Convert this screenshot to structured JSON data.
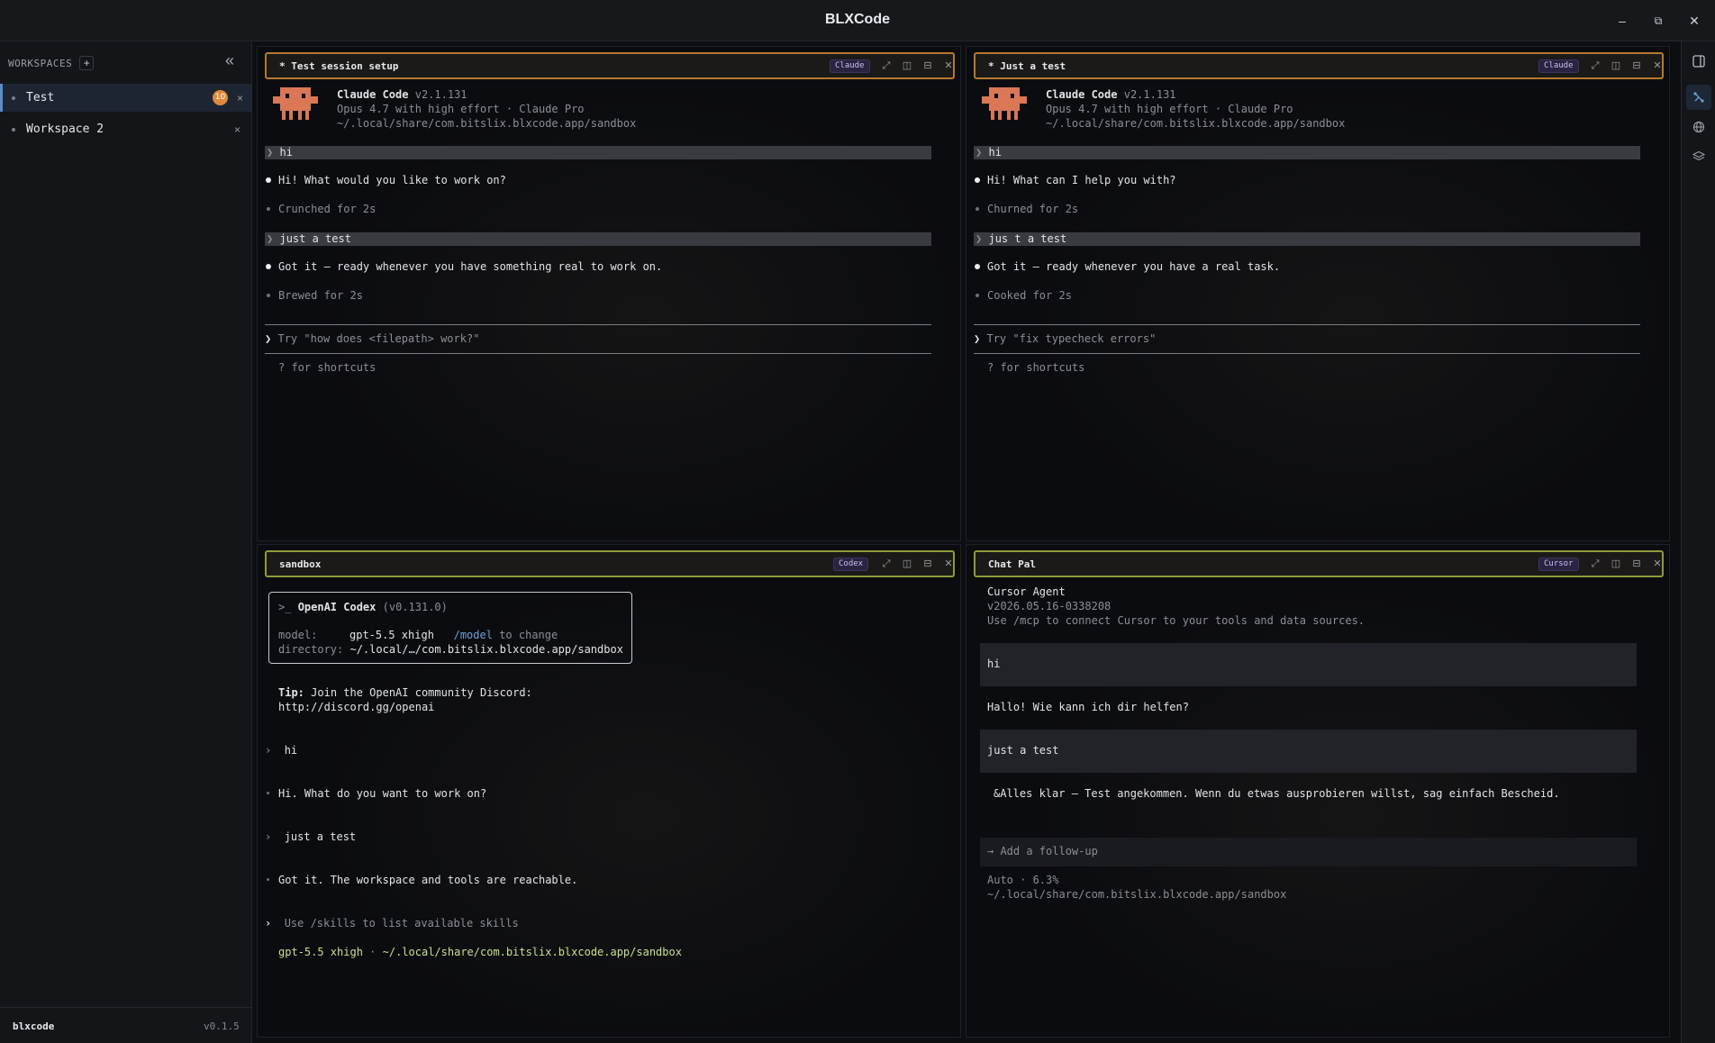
{
  "window": {
    "title": "BLXCode",
    "controls": {
      "minimize": "–",
      "restore": "⧉",
      "close": "✕"
    }
  },
  "sidebar": {
    "header_label": "WORKSPACES",
    "add_label": "+",
    "collapse_label": "«",
    "workspaces": [
      {
        "name": "Test",
        "badge": "10",
        "close": "×",
        "active": true
      },
      {
        "name": "Workspace 2",
        "badge": "",
        "close": "×",
        "active": false
      }
    ],
    "footer": {
      "app": "blxcode",
      "version": "v0.1.5"
    }
  },
  "colors": {
    "accent_orange": "#b47a2c",
    "accent_green": "#8f9a3b",
    "badge_orange": "#e08a3c",
    "active_blue": "#5a8bd0"
  },
  "panes": [
    {
      "title": "* Test session setup",
      "agent": "Claude",
      "agent_ver": {
        "name": "Claude Code",
        "version": "v2.1.131",
        "model": "Opus 4.7 with high effort · Claude Pro",
        "dir": "~/.local/share/com.bitslix.blxcode.app/sandbox"
      },
      "messages": [
        {
          "kind": "user",
          "text": "hi"
        },
        {
          "kind": "assistant",
          "text": "Hi! What would you like to work on?"
        },
        {
          "kind": "status",
          "text": "Crunched for 2s"
        },
        {
          "kind": "user",
          "text": "just a test"
        },
        {
          "kind": "assistant",
          "text": "Got it — ready whenever you have something real to work on."
        },
        {
          "kind": "status",
          "text": "Brewed for 2s"
        }
      ],
      "prompt_placeholder": "Try \"how does <filepath> work?\"",
      "hint": "? for shortcuts"
    },
    {
      "title": "* Just a test",
      "agent": "Claude",
      "agent_ver": {
        "name": "Claude Code",
        "version": "v2.1.131",
        "model": "Opus 4.7 with high effort · Claude Pro",
        "dir": "~/.local/share/com.bitslix.blxcode.app/sandbox"
      },
      "messages": [
        {
          "kind": "user",
          "text": "hi"
        },
        {
          "kind": "assistant",
          "text": "Hi! What can I help you with?"
        },
        {
          "kind": "status",
          "text": "Churned for 2s"
        },
        {
          "kind": "user",
          "text": "jus t a test"
        },
        {
          "kind": "assistant",
          "text": "Got it — ready whenever you have a real task."
        },
        {
          "kind": "status",
          "text": "Cooked for 2s"
        }
      ],
      "prompt_placeholder": "Try \"fix typecheck errors\"",
      "hint": "? for shortcuts"
    },
    {
      "title": "sandbox",
      "agent": "Codex",
      "box": {
        "prefix": ">_",
        "name": "OpenAI Codex",
        "version": "(v0.131.0)",
        "model_label": "model:",
        "model_value": "gpt-5.5 xhigh",
        "model_cmd": "/model",
        "model_hint": "to change",
        "dir_label": "directory:",
        "dir_value": "~/.local/…/com.bitslix.blxcode.app/sandbox"
      },
      "tip_label": "Tip:",
      "tip_text": "Join the OpenAI community Discord:",
      "tip_url": "http://discord.gg/openai",
      "messages": [
        {
          "kind": "user",
          "text": "hi"
        },
        {
          "kind": "assistant",
          "text": "Hi. What do you want to work on?"
        },
        {
          "kind": "user",
          "text": "just a test"
        },
        {
          "kind": "assistant",
          "text": "Got it. The workspace and tools are reachable."
        }
      ],
      "prompt_placeholder": "Use /skills to list available skills",
      "status_model": "gpt-5.5 xhigh",
      "status_sep": "·",
      "status_dir": "~/.local/share/com.bitslix.blxcode.app/sandbox"
    },
    {
      "title": "Chat Pal",
      "agent": "Cursor",
      "intro_name": "Cursor Agent",
      "intro_version": "v2026.05.16-0338208",
      "intro_help": "Use /mcp to connect Cursor to your tools and data sources.",
      "messages": [
        {
          "kind": "user",
          "text": "hi"
        },
        {
          "kind": "assistant",
          "text": "Hallo! Wie kann ich dir helfen?"
        },
        {
          "kind": "user",
          "text": "just a test"
        },
        {
          "kind": "assistant",
          "text": "&Alles klar — Test angekommen. Wenn du etwas ausprobieren willst, sag einfach Bescheid."
        }
      ],
      "followup_placeholder": "→ Add a follow-up",
      "status_mode": "Auto · 6.3%",
      "status_dir": "~/.local/share/com.bitslix.blxcode.app/sandbox"
    }
  ],
  "pane_icons": [
    "expand-icon",
    "split-vertical-icon",
    "split-horizontal-icon",
    "close-icon"
  ],
  "rail_icons": [
    "panel-toggle-icon",
    "agents-icon",
    "globe-icon",
    "layers-icon"
  ]
}
